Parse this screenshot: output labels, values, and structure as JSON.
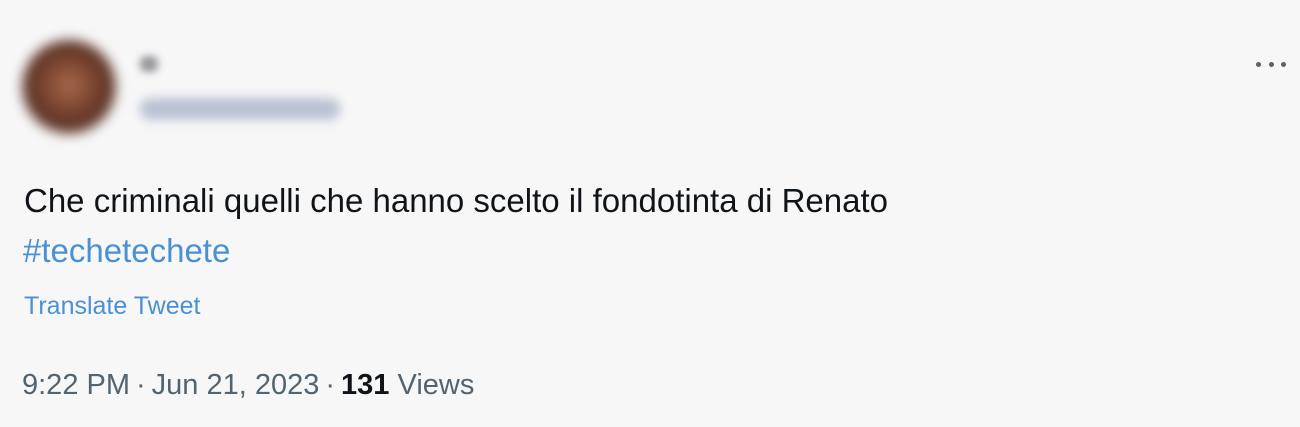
{
  "tweet": {
    "text": "Che criminali quelli che hanno scelto il fondotinta di Renato",
    "hashtag": "#techetechete",
    "translate_label": "Translate Tweet",
    "time": "9:22 PM",
    "separator": "·",
    "date": "Jun 21, 2023",
    "views_count": "131",
    "views_label": "Views"
  },
  "colors": {
    "text": "#0f1419",
    "link": "#4a90d4",
    "muted": "#536471",
    "background": "#f7f7f7"
  },
  "icons": {
    "more": "more-horizontal-icon"
  }
}
